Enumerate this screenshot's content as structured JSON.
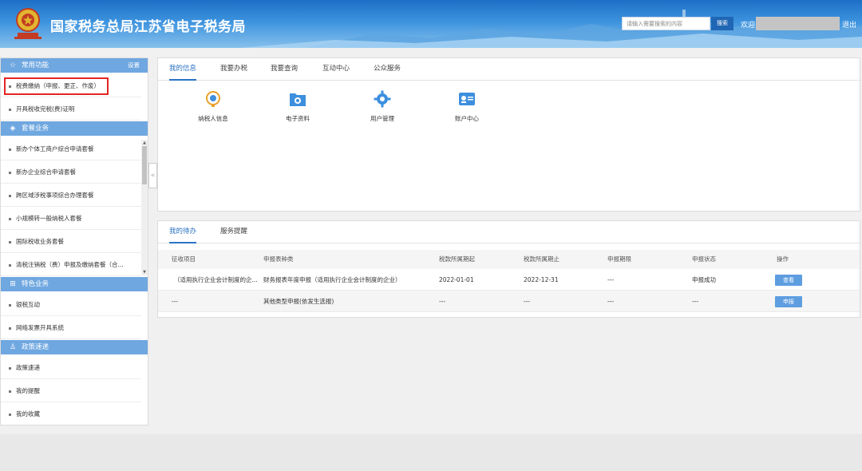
{
  "header": {
    "title": "国家税务总局江苏省电子税务局",
    "search_placeholder": "请输入需要搜索的内容",
    "search_button": "搜索",
    "welcome": "欢迎",
    "logout": "退出",
    "brand_color": "#1d6fc6"
  },
  "sidebar": {
    "sections": [
      {
        "title": "常用功能",
        "icon": "star-icon",
        "action": "设置",
        "items": [
          "税费缴纳（申报、更正、作废）",
          "开具税收完税(费)证明"
        ]
      },
      {
        "title": "套餐业务",
        "icon": "layers-icon",
        "items": [
          "新办个体工商户综合申请套餐",
          "新办企业综合申请套餐",
          "跨区域涉税事项综合办理套餐",
          "小规模转一般纳税人套餐",
          "国际税收业务套餐",
          "清税注销税（费）申报及缴纳套餐（合..."
        ]
      },
      {
        "title": "特色业务",
        "icon": "grid-icon",
        "items": [
          "银税互动",
          "网络发票开具系统"
        ]
      },
      {
        "title": "政策速递",
        "icon": "user-icon",
        "items": [
          "政策速递",
          "我的提醒",
          "我的收藏"
        ]
      }
    ],
    "collapse_glyph": "«"
  },
  "main_tabs": [
    "我的信息",
    "我要办税",
    "我要查询",
    "互动中心",
    "公众服务"
  ],
  "functions": [
    {
      "label": "纳税人信息",
      "icon": "taxpayer-info-icon"
    },
    {
      "label": "电子资料",
      "icon": "folder-icon"
    },
    {
      "label": "用户管理",
      "icon": "gear-icon"
    },
    {
      "label": "账户中心",
      "icon": "id-card-icon"
    }
  ],
  "todo": {
    "tabs": [
      "我的待办",
      "服务提醒"
    ],
    "columns": [
      "征收项目",
      "申报表种类",
      "税款所属期起",
      "税款所属期止",
      "申报期限",
      "申报状态",
      "操作"
    ],
    "rows": [
      {
        "item": "（适用执行企业会计制度的企...",
        "form": "财务报表年度申报（适用执行企业会计制度的企业）",
        "start": "2022-01-01",
        "end": "2022-12-31",
        "deadline": "---",
        "status": "申报成功",
        "action": "查看"
      },
      {
        "item": "---",
        "form": "其他类型申报(依发生选报)",
        "start": "---",
        "end": "---",
        "deadline": "---",
        "status": "---",
        "action": "申报"
      }
    ]
  }
}
